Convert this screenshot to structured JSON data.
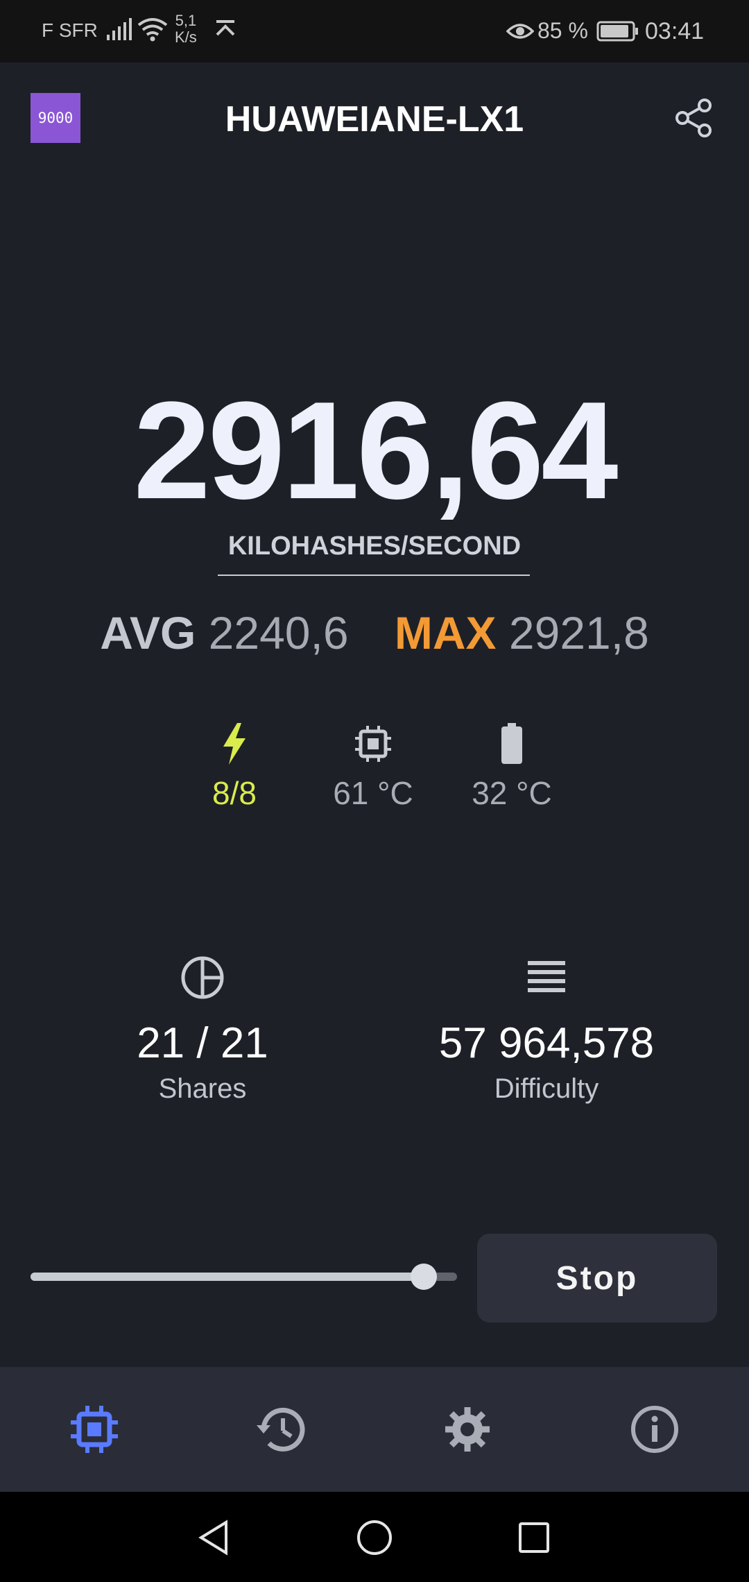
{
  "status_bar": {
    "carrier": "F SFR",
    "net_speed_value": "5,1",
    "net_speed_unit": "K/s",
    "battery_percent": "85 %",
    "time": "03:41",
    "icons": [
      "signal-icon",
      "wifi-icon",
      "upload-arrow-icon",
      "eye-comfort-icon",
      "battery-icon"
    ]
  },
  "header": {
    "logo_text": "9000",
    "device_name": "HUAWEIANE-LX1",
    "share_icon": "share-icon"
  },
  "hashrate": {
    "value": "2916,64",
    "unit": "KILOHASHES/SECOND",
    "avg_label": "AVG",
    "avg_value": "2240,6",
    "max_label": "MAX",
    "max_value": "2921,8"
  },
  "mini_stats": {
    "threads": "8/8",
    "cpu_temp": "61 °C",
    "battery_temp": "32 °C"
  },
  "counters": {
    "shares_value": "21 / 21",
    "shares_label": "Shares",
    "difficulty_value": "57 964,578",
    "difficulty_label": "Difficulty"
  },
  "controls": {
    "slider_fraction": 0.95,
    "stop_label": "Stop"
  },
  "bottom_nav": {
    "items": [
      "miner-icon",
      "history-icon",
      "settings-icon",
      "info-icon"
    ],
    "active": "miner-icon"
  },
  "colors": {
    "background": "#1e2028",
    "accent": "#5a7bff",
    "max_color": "#f39a35",
    "threads_color": "#d9ec4c",
    "logo_bg": "#8a56d6"
  }
}
